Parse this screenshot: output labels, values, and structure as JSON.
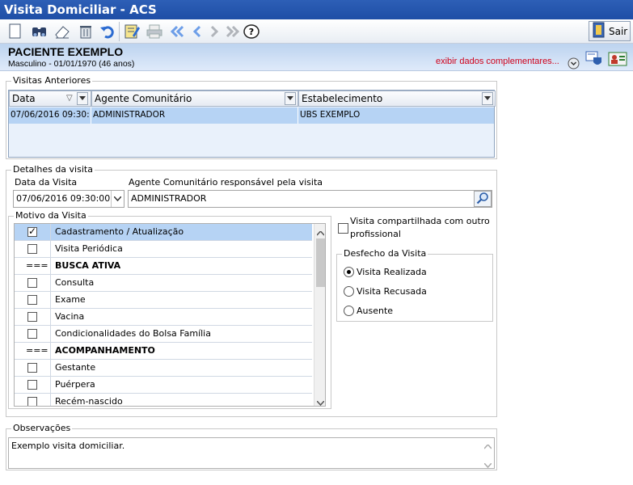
{
  "window": {
    "title": "Visita Domiciliar - ACS"
  },
  "toolbar": {
    "icons": [
      "new-icon",
      "search-icon",
      "eraser-icon",
      "trash-icon",
      "undo-icon",
      "edit-icon",
      "print-icon",
      "first-icon",
      "prev-icon",
      "next-icon",
      "last-icon",
      "help-icon"
    ],
    "exit_label": "Sair"
  },
  "patient": {
    "name": "PACIENTE EXEMPLO",
    "info": "Masculino - 01/01/1970 (46 anos)",
    "more_link": "exibir dados complementares..."
  },
  "previous_visits": {
    "legend": "Visitas Anteriores",
    "columns": [
      "Data",
      "Agente Comunitário",
      "Estabelecimento"
    ],
    "rows": [
      {
        "data": "07/06/2016 09:30:",
        "agente": "ADMINISTRADOR",
        "estabelecimento": "UBS EXEMPLO"
      }
    ]
  },
  "details": {
    "legend": "Detalhes da visita",
    "date_label": "Data da Visita",
    "date_value": "07/06/2016 09:30:00",
    "agent_label": "Agente Comunitário responsável pela visita",
    "agent_value": "ADMINISTRADOR"
  },
  "motivo": {
    "legend": "Motivo da Visita",
    "items": [
      {
        "text": "Cadastramento / Atualização",
        "type": "check",
        "checked": true
      },
      {
        "text": "Visita Periódica",
        "type": "check",
        "checked": false
      },
      {
        "text": "BUSCA ATIVA",
        "type": "header",
        "marker": "==="
      },
      {
        "text": "Consulta",
        "type": "check",
        "checked": false
      },
      {
        "text": "Exame",
        "type": "check",
        "checked": false
      },
      {
        "text": "Vacina",
        "type": "check",
        "checked": false
      },
      {
        "text": "Condicionalidades do Bolsa Família",
        "type": "check",
        "checked": false
      },
      {
        "text": "ACOMPANHAMENTO",
        "type": "header",
        "marker": "==="
      },
      {
        "text": "Gestante",
        "type": "check",
        "checked": false
      },
      {
        "text": "Puérpera",
        "type": "check",
        "checked": false
      },
      {
        "text": "Recém-nascido",
        "type": "check",
        "checked": false
      }
    ]
  },
  "shared": {
    "label_line1": "Visita compartilhada com outro",
    "label_line2": "profissional",
    "checked": false
  },
  "outcome": {
    "legend": "Desfecho da Visita",
    "options": [
      {
        "label": "Visita Realizada",
        "selected": true
      },
      {
        "label": "Visita Recusada",
        "selected": false
      },
      {
        "label": "Ausente",
        "selected": false
      }
    ]
  },
  "observations": {
    "legend": "Observações",
    "value": "Exemplo visita domiciliar."
  },
  "colors": {
    "title_bg": "#2d5fb6",
    "link_red": "#d0021b",
    "selection": "#b6d3f4"
  }
}
